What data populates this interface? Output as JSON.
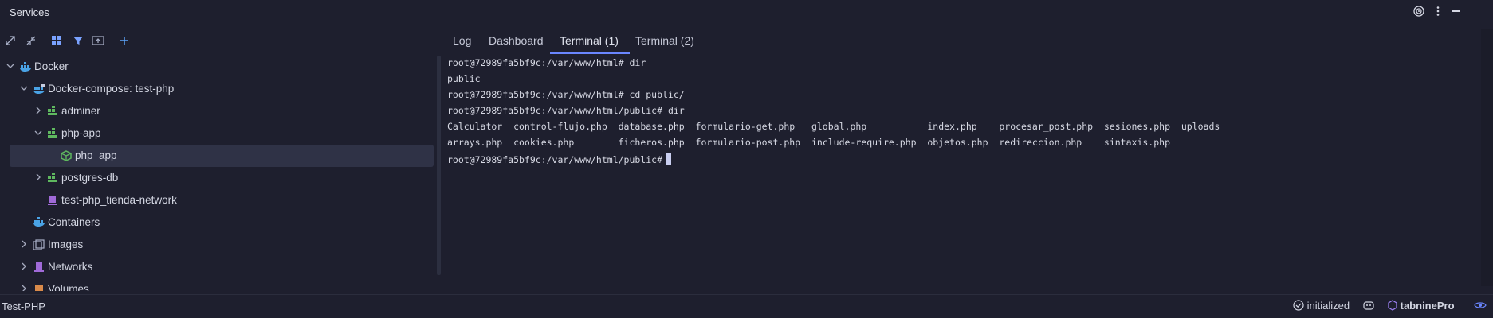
{
  "titlebar": {
    "title": "Services",
    "icons": [
      "target-icon",
      "kebab-menu-icon",
      "minimize-icon"
    ]
  },
  "toolbar": {
    "icons": [
      "expand-all-icon",
      "collapse-all-icon",
      "group-icon",
      "filter-icon",
      "new-tab-icon",
      "add-icon"
    ]
  },
  "tree": {
    "items": [
      {
        "label": "Docker",
        "icon": "docker-icon"
      },
      {
        "label": "Docker-compose: test-php",
        "icon": "docker-compose-icon"
      },
      {
        "label": "adminer",
        "icon": "service-icon"
      },
      {
        "label": "php-app",
        "icon": "service-icon"
      },
      {
        "label": "php_app",
        "icon": "container-icon"
      },
      {
        "label": "postgres-db",
        "icon": "service-icon"
      },
      {
        "label": "test-php_tienda-network",
        "icon": "network-icon"
      },
      {
        "label": "Containers",
        "icon": "containers-icon"
      },
      {
        "label": "Images",
        "icon": "images-icon"
      },
      {
        "label": "Networks",
        "icon": "network-icon"
      },
      {
        "label": "Volumes",
        "icon": "volume-icon"
      }
    ]
  },
  "tabs": [
    {
      "label": "Log"
    },
    {
      "label": "Dashboard"
    },
    {
      "label": "Terminal (1)"
    },
    {
      "label": "Terminal (2)"
    }
  ],
  "terminal": {
    "lines": [
      "root@72989fa5bf9c:/var/www/html# dir",
      "public",
      "root@72989fa5bf9c:/var/www/html# cd public/",
      "root@72989fa5bf9c:/var/www/html/public# dir",
      "Calculator  control-flujo.php  database.php  formulario-get.php   global.php           index.php    procesar_post.php  sesiones.php  uploads",
      "arrays.php  cookies.php        ficheros.php  formulario-post.php  include-require.php  objetos.php  redireccion.php    sintaxis.php",
      "root@72989fa5bf9c:/var/www/html/public#"
    ]
  },
  "statusbar": {
    "project": "Test-PHP",
    "status": "initialized",
    "plugin_name": "tabnine",
    "plugin_tier": "Pro"
  },
  "colors": {
    "background": "#1e1f2e",
    "accent": "#6a86ff",
    "docker_blue": "#4aa3e6",
    "compose_green": "#5fb85f",
    "network_purple": "#a06ad8"
  }
}
